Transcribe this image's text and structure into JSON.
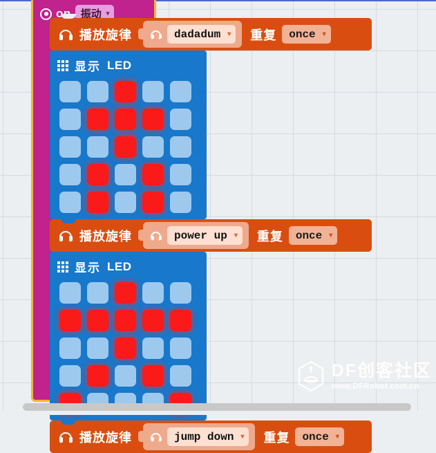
{
  "app": {
    "editor": "makecode-blocks-workspace",
    "background_color": "#ECEFF1",
    "top_border_color": "#4B68CE"
  },
  "event_block": {
    "name": "on-shake-event",
    "color": "#C0228E",
    "outline_color": "#F2B632",
    "icon": "target-icon",
    "label": "on",
    "dropdown_value": "振动",
    "dropdown_caret": "▾"
  },
  "blocks": [
    {
      "type": "play-melody",
      "color": "#D94E10",
      "icon": "headphone-icon",
      "label": "播放旋律",
      "melody_icon": "headphone-icon",
      "melody_value": "dadadum",
      "melody_caret": "▾",
      "repeat_label": "重复",
      "repeat_value": "once",
      "repeat_caret": "▾"
    },
    {
      "type": "show-leds",
      "color": "#1878CB",
      "icon": "grid-icon",
      "label_cn": "显示",
      "label_en": "LED",
      "on_color": "#FB1A1A",
      "off_color": "#9EC9EE",
      "matrix": [
        [
          0,
          0,
          1,
          0,
          0
        ],
        [
          0,
          1,
          1,
          1,
          0
        ],
        [
          0,
          0,
          1,
          0,
          0
        ],
        [
          0,
          1,
          0,
          1,
          0
        ],
        [
          0,
          1,
          0,
          1,
          0
        ]
      ]
    },
    {
      "type": "play-melody",
      "color": "#D94E10",
      "icon": "headphone-icon",
      "label": "播放旋律",
      "melody_icon": "headphone-icon",
      "melody_value": "power up",
      "melody_caret": "▾",
      "repeat_label": "重复",
      "repeat_value": "once",
      "repeat_caret": "▾"
    },
    {
      "type": "show-leds",
      "color": "#1878CB",
      "icon": "grid-icon",
      "label_cn": "显示",
      "label_en": "LED",
      "on_color": "#FB1A1A",
      "off_color": "#9EC9EE",
      "matrix": [
        [
          0,
          0,
          1,
          0,
          0
        ],
        [
          1,
          1,
          1,
          1,
          1
        ],
        [
          0,
          0,
          1,
          0,
          0
        ],
        [
          0,
          1,
          0,
          1,
          0
        ],
        [
          1,
          0,
          0,
          0,
          1
        ]
      ]
    },
    {
      "type": "play-melody",
      "color": "#D94E10",
      "icon": "headphone-icon",
      "label": "播放旋律",
      "melody_icon": "headphone-icon",
      "melody_value": "jump down",
      "melody_caret": "▾",
      "repeat_label": "重复",
      "repeat_value": "once",
      "repeat_caret": "▾"
    }
  ],
  "watermark": {
    "logo": "dfrobot-logo-icon",
    "title": "DF创客社区",
    "url": "www.DFRobot.com.cn"
  },
  "scrollbar": {
    "name": "horizontal-scrollbar",
    "thumb_color": "#C8C8C8"
  }
}
